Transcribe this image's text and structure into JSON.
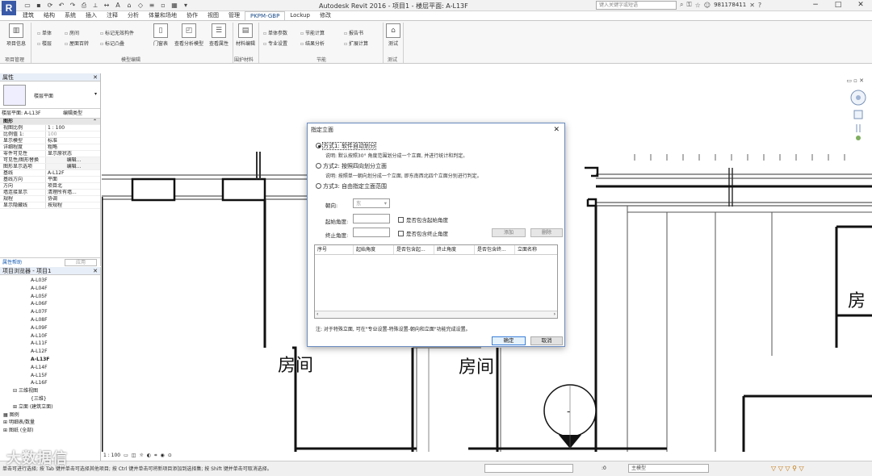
{
  "app": {
    "title": "Autodesk Revit 2016 -    项目1 - 楼层平面: A-L13F",
    "logo": "R",
    "search_placeholder": "键入关键字或短语",
    "user": "981178411",
    "window_buttons": [
      "−",
      "□",
      "✕"
    ]
  },
  "ribbon": {
    "tabs": [
      "建筑",
      "结构",
      "系统",
      "插入",
      "注释",
      "分析",
      "体量和场地",
      "协作",
      "视图",
      "管理",
      "PKPM-GBP",
      "Lockup",
      "修改"
    ],
    "active_tab": "PKPM-GBP",
    "buttons": {
      "project_info": "项目信息",
      "door_window": "门窗表",
      "analysis_model": "查看分析模型",
      "view_props": "查看属性",
      "material_edit": "材料编辑",
      "test": "测试"
    },
    "items": {
      "unit": "单体",
      "room": "房间",
      "mark_invalid": "标记无效构件",
      "floor": "楼层",
      "roof_window": "屋面百转",
      "mark_overlap": "标记凸叠",
      "unit_params": "单体参数",
      "energy_calc": "节能计算",
      "report": "报告书",
      "pro_settings": "专业设置",
      "result_analysis": "结果分析",
      "ext_calc": "扩展计算"
    },
    "groups": [
      "项目管理",
      "模型编辑",
      "围护材料",
      "节能",
      "测试"
    ]
  },
  "properties": {
    "header": "属性",
    "type_name": "楼层平面",
    "instance": "楼层平面: A-L13F",
    "edit_type": "编辑类型",
    "category": "图形",
    "rows": [
      {
        "k": "视图比例",
        "v": "1 : 100"
      },
      {
        "k": "比例值 1:",
        "v": "100"
      },
      {
        "k": "显示模型",
        "v": "标准"
      },
      {
        "k": "详细程度",
        "v": "粗略"
      },
      {
        "k": "零件可见性",
        "v": "显示原状态"
      },
      {
        "k": "可见性/图形替换",
        "v": "编辑..."
      },
      {
        "k": "图形显示选项",
        "v": "编辑..."
      },
      {
        "k": "基线",
        "v": "A-L12F"
      },
      {
        "k": "基线方向",
        "v": "平面"
      },
      {
        "k": "方向",
        "v": "项目北"
      },
      {
        "k": "墙连接显示",
        "v": "清理所有墙..."
      },
      {
        "k": "规程",
        "v": "协调"
      },
      {
        "k": "显示隐藏线",
        "v": "按规程"
      }
    ],
    "help": "属性帮助",
    "apply": "应用"
  },
  "browser": {
    "header": "项目浏览器 - 项目1",
    "floors": [
      "A-L03F",
      "A-L04F",
      "A-L05F",
      "A-L06F",
      "A-L07F",
      "A-L08F",
      "A-L09F",
      "A-L10F",
      "A-L11F",
      "A-L12F",
      "A-L13F",
      "A-L14F",
      "A-L15F",
      "A-L16F"
    ],
    "active_floor": "A-L13F",
    "three_d": "三维视图",
    "three_d_child": "{三维}",
    "elevation": "立面 (建筑立面)",
    "legend": "图例",
    "schedules": "明细表/数量",
    "sheets": "图纸 (全部)"
  },
  "canvas": {
    "room_label": "房间",
    "room_partial": "房",
    "minus": "-"
  },
  "dialog": {
    "title": "指定立面",
    "options": [
      {
        "label": "方式1: 软件自动划分",
        "desc": "说明: 默认按照30° 角度范围划分成一个立面, 并进行统计和判定。",
        "checked": true
      },
      {
        "label": "方式2: 按照四向划分立面",
        "desc": "说明: 按照单一朝向划分成一个立面, 即东南西北四个立面分别进行判定。",
        "checked": false
      },
      {
        "label": "方式3: 自由指定立面范围",
        "desc": "",
        "checked": false
      }
    ],
    "orientation_label": "朝向:",
    "orientation_value": "东",
    "start_angle_label": "起始角度:",
    "end_angle_label": "终止角度:",
    "include_start": "是否包含起始角度",
    "include_end": "是否包含终止角度",
    "add": "添加",
    "delete": "删除",
    "columns": [
      "序号",
      "起始角度",
      "是否包含起...",
      "终止角度",
      "是否包含终...",
      "立面名称"
    ],
    "note": "注: 对于特殊立面, 可在\"专业设置-特殊设置-朝向和立面\"功能完成设置。",
    "ok": "确定",
    "cancel": "取消"
  },
  "status": {
    "scale": "1 : 100",
    "message": "单击可进行选择; 按 Tab 键并单击可选择其他项目; 按 Ctrl 键并单击可将新项目添加到选择集; 按 Shift 键并单击可取消选择。",
    "zero": ":0",
    "model": "主模型",
    "watermark": "大数据信"
  }
}
